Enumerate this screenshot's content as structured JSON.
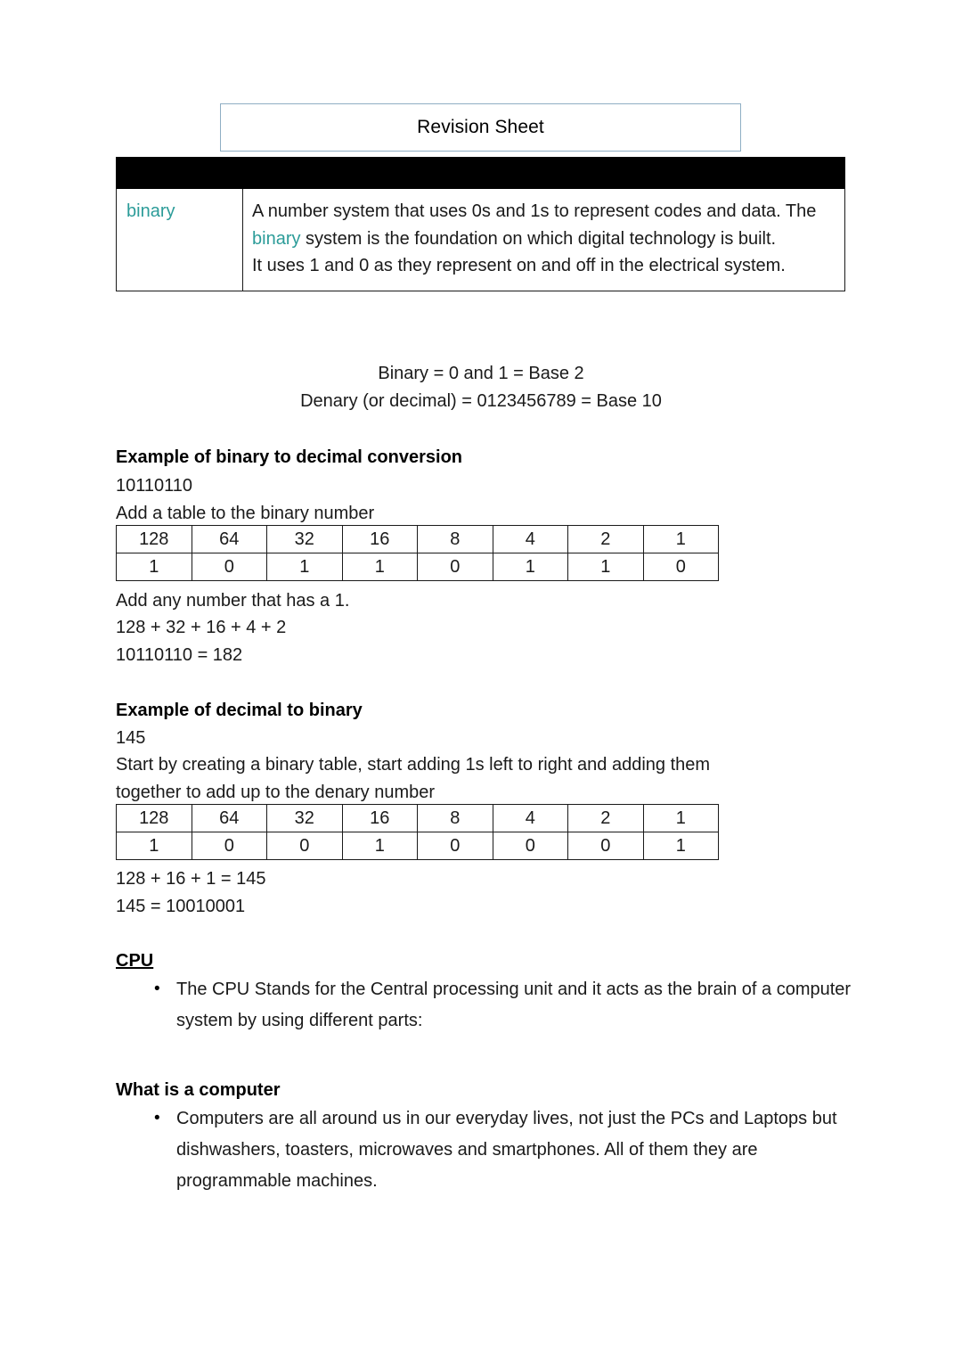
{
  "document": {
    "title": "Revision Sheet"
  },
  "glossary": {
    "header_bar": "",
    "term": "binary",
    "definition_part1": "A number system that uses 0s and 1s to represent codes and data. The ",
    "definition_highlight": "binary",
    "definition_part2": " system is the foundation on which digital technology is built.",
    "definition_line2": "It uses 1 and 0 as they represent on and off in the electrical system."
  },
  "base_notes": {
    "line1": "Binary  = 0 and 1 = Base 2",
    "line2": "Denary (or decimal) = 0123456789 = Base 10"
  },
  "binary_to_decimal": {
    "heading": "Example of binary to decimal conversion",
    "number": "10110110",
    "instruction": "Add a table to the binary number",
    "table": {
      "place_values": [
        "128",
        "64",
        "32",
        "16",
        "8",
        "4",
        "2",
        "1"
      ],
      "bits": [
        "1",
        "0",
        "1",
        "1",
        "0",
        "1",
        "1",
        "0"
      ]
    },
    "step1": "Add any number that has a 1.",
    "step2": "128 + 32 + 16 + 4 + 2",
    "result": "10110110 =  182"
  },
  "decimal_to_binary": {
    "heading": "Example of decimal to binary",
    "number": "145",
    "instruction_line1": "Start by creating a binary table,  start adding 1s left to right and adding them",
    "instruction_line2": "together to add up to the denary number",
    "table": {
      "place_values": [
        "128",
        "64",
        "32",
        "16",
        "8",
        "4",
        "2",
        "1"
      ],
      "bits": [
        "1",
        "0",
        "0",
        "1",
        "0",
        "0",
        "0",
        "1"
      ]
    },
    "sum": "128 + 16 + 1 = 145",
    "result": "145 = 10010001"
  },
  "cpu_section": {
    "heading": "CPU",
    "bullets": [
      "The CPU Stands for the Central processing unit and it acts as the brain of a computer system by using different parts:"
    ]
  },
  "computer_section": {
    "heading": "What is a computer",
    "bullets": [
      "Computers are all around us in our everyday lives, not just the PCs and Laptops but dishwashers, toasters, microwaves and smartphones. All of them they are programmable machines."
    ]
  },
  "colors": {
    "term_teal": "#2c9c99",
    "title_border": "#8faec4",
    "header_bar": "#000000",
    "text": "#1a1a1a"
  }
}
